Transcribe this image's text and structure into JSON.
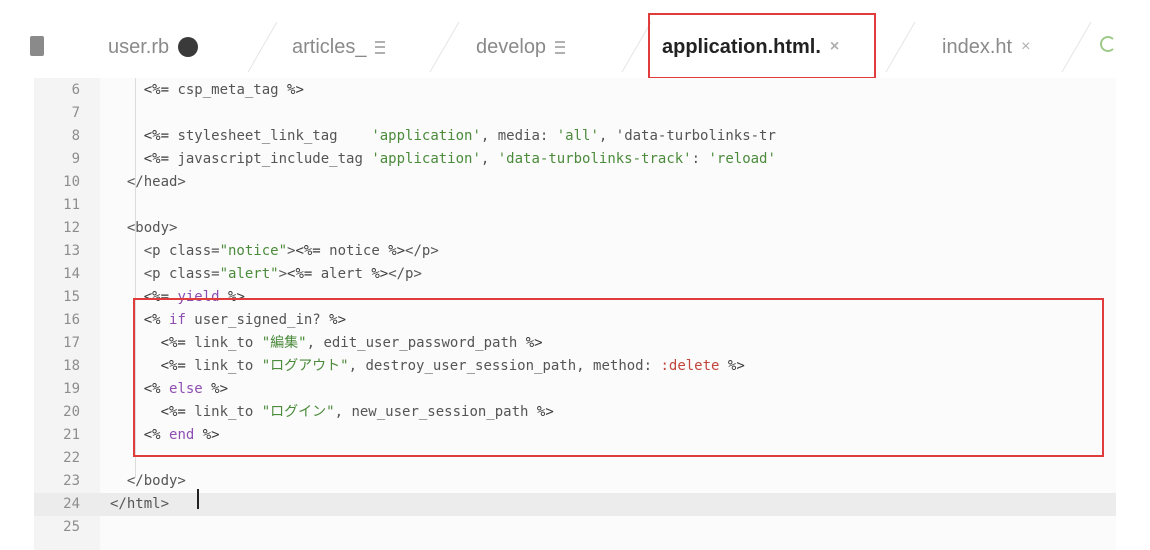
{
  "tabs": [
    {
      "label": "user.rb",
      "marker": "dirty",
      "active": false
    },
    {
      "label": "articles_",
      "marker": "menu",
      "active": false
    },
    {
      "label": "develop",
      "marker": "menu",
      "active": false
    },
    {
      "label": "application.html.",
      "marker": "close",
      "active": true
    },
    {
      "label": "index.ht",
      "marker": "close",
      "active": false
    }
  ],
  "close_glyph": "×",
  "lines": [
    {
      "num": "6",
      "code": "    <%= csp_meta_tag %>"
    },
    {
      "num": "7",
      "code": ""
    },
    {
      "num": "8",
      "code": "    <%= stylesheet_link_tag    'application', media: 'all', 'data-turbolinks-tr"
    },
    {
      "num": "9",
      "code": "    <%= javascript_include_tag 'application', 'data-turbolinks-track': 'reload'"
    },
    {
      "num": "10",
      "code": "  </head>"
    },
    {
      "num": "11",
      "code": ""
    },
    {
      "num": "12",
      "code": "  <body>"
    },
    {
      "num": "13",
      "code": "    <p class=\"notice\"><%= notice %></p>"
    },
    {
      "num": "14",
      "code": "    <p class=\"alert\"><%= alert %></p>"
    },
    {
      "num": "15",
      "code": "    <%= yield %>"
    },
    {
      "num": "16",
      "code": "    <% if user_signed_in? %>"
    },
    {
      "num": "17",
      "code": "      <%= link_to \"編集\", edit_user_password_path %>"
    },
    {
      "num": "18",
      "code": "      <%= link_to \"ログアウト\", destroy_user_session_path, method: :delete %>"
    },
    {
      "num": "19",
      "code": "    <% else %>"
    },
    {
      "num": "20",
      "code": "      <%= link_to \"ログイン\", new_user_session_path %>"
    },
    {
      "num": "21",
      "code": "    <% end %>"
    },
    {
      "num": "22",
      "code": ""
    },
    {
      "num": "23",
      "code": "  </body>"
    },
    {
      "num": "24",
      "code": "</html>"
    },
    {
      "num": "25",
      "code": ""
    }
  ],
  "current_line": "24",
  "colors": {
    "highlight_border": "#e03c3c",
    "string": "#4b8b3b",
    "keyword": "#8e4fb3",
    "symbol": "#c2453a"
  }
}
